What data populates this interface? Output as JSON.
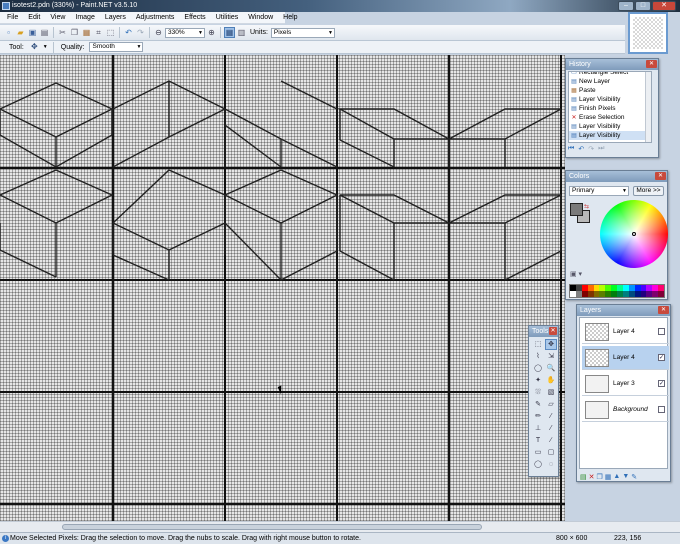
{
  "window": {
    "title": "isotest2.pdn (330%) - Paint.NET v3.5.10",
    "minimize": "–",
    "maximize": "□",
    "close": "✕"
  },
  "menu": [
    "File",
    "Edit",
    "View",
    "Image",
    "Layers",
    "Adjustments",
    "Effects",
    "Utilities",
    "Window",
    "Help"
  ],
  "toolbar": {
    "zoom_value": "330%",
    "units_label": "Units:",
    "units_value": "Pixels"
  },
  "toolbar2": {
    "tool_label": "Tool:",
    "quality_label": "Quality:",
    "quality_value": "Smooth"
  },
  "history": {
    "title": "History",
    "items": [
      {
        "label": "Rectangle Select",
        "icon": "rect-select-icon",
        "glyph": "▭",
        "color": "#3a6fb0"
      },
      {
        "label": "New Layer",
        "icon": "new-layer-icon",
        "glyph": "▤",
        "color": "#3a6fb0"
      },
      {
        "label": "Paste",
        "icon": "paste-icon",
        "glyph": "▦",
        "color": "#a8703a"
      },
      {
        "label": "Layer Visibility",
        "icon": "layer-visibility-icon",
        "glyph": "▤",
        "color": "#3a6fb0"
      },
      {
        "label": "Finish Pixels",
        "icon": "finish-pixels-icon",
        "glyph": "▤",
        "color": "#3a6fb0"
      },
      {
        "label": "Erase Selection",
        "icon": "erase-icon",
        "glyph": "✕",
        "color": "#c82020"
      },
      {
        "label": "Layer Visibility",
        "icon": "layer-visibility-icon",
        "glyph": "▤",
        "color": "#3a6fb0"
      },
      {
        "label": "Layer Visibility",
        "icon": "layer-visibility-icon",
        "glyph": "▤",
        "color": "#3a6fb0",
        "selected": true
      }
    ]
  },
  "colors": {
    "title": "Colors",
    "mode": "Primary",
    "more_label": "More >>",
    "primary": "#7a7a7a",
    "secondary": "#b9b9b9",
    "palette": [
      "#000000",
      "#404040",
      "#ff0000",
      "#ff6a00",
      "#ffd800",
      "#b6ff00",
      "#4cff00",
      "#00ff21",
      "#00ff90",
      "#00ffff",
      "#0094ff",
      "#0026ff",
      "#4800ff",
      "#b200ff",
      "#ff00dc",
      "#ff006e",
      "#ffffff",
      "#808080",
      "#7f0000",
      "#7f3300",
      "#7f6a00",
      "#5b7f00",
      "#267f00",
      "#007f0e",
      "#007f46",
      "#007f7f",
      "#004a7f",
      "#00137f",
      "#21007f",
      "#57007f",
      "#7f006e",
      "#7f0037"
    ]
  },
  "tools": {
    "title": "Tools",
    "items": [
      {
        "name": "rectangle-select",
        "glyph": "⬚"
      },
      {
        "name": "move-selected-pixels",
        "glyph": "✥",
        "active": true
      },
      {
        "name": "lasso-select",
        "glyph": "⌇"
      },
      {
        "name": "move-selection",
        "glyph": "⇲"
      },
      {
        "name": "ellipse-select",
        "glyph": "◯"
      },
      {
        "name": "zoom",
        "glyph": "🔍"
      },
      {
        "name": "magic-wand",
        "glyph": "✦"
      },
      {
        "name": "pan",
        "glyph": "✋"
      },
      {
        "name": "paint-bucket",
        "glyph": "⛆"
      },
      {
        "name": "gradient",
        "glyph": "▧"
      },
      {
        "name": "paintbrush",
        "glyph": "✎"
      },
      {
        "name": "eraser",
        "glyph": "▱"
      },
      {
        "name": "pencil",
        "glyph": "✏"
      },
      {
        "name": "color-picker",
        "glyph": "⁄"
      },
      {
        "name": "clone-stamp",
        "glyph": "⊥"
      },
      {
        "name": "recolor",
        "glyph": "⁄"
      },
      {
        "name": "text",
        "glyph": "T"
      },
      {
        "name": "line-curve",
        "glyph": "∕"
      },
      {
        "name": "rectangle",
        "glyph": "▭"
      },
      {
        "name": "rounded-rectangle",
        "glyph": "▢"
      },
      {
        "name": "ellipse",
        "glyph": "◯"
      },
      {
        "name": "freeform-shape",
        "glyph": "◌"
      }
    ]
  },
  "layers": {
    "title": "Layers",
    "items": [
      {
        "name": "Layer 4",
        "checked": "",
        "transparent": true
      },
      {
        "name": "Layer 4",
        "checked": "✓",
        "transparent": true,
        "selected": true
      },
      {
        "name": "Layer 3",
        "checked": "✓",
        "transparent": false
      },
      {
        "name": "Background",
        "checked": "",
        "transparent": false,
        "italic": true
      }
    ]
  },
  "status": {
    "message": "Move Selected Pixels: Drag the selection to move. Drag the nubs to scale. Drag with right mouse button to rotate.",
    "image_size": "800 × 600",
    "cursor_pos": "223, 156"
  }
}
